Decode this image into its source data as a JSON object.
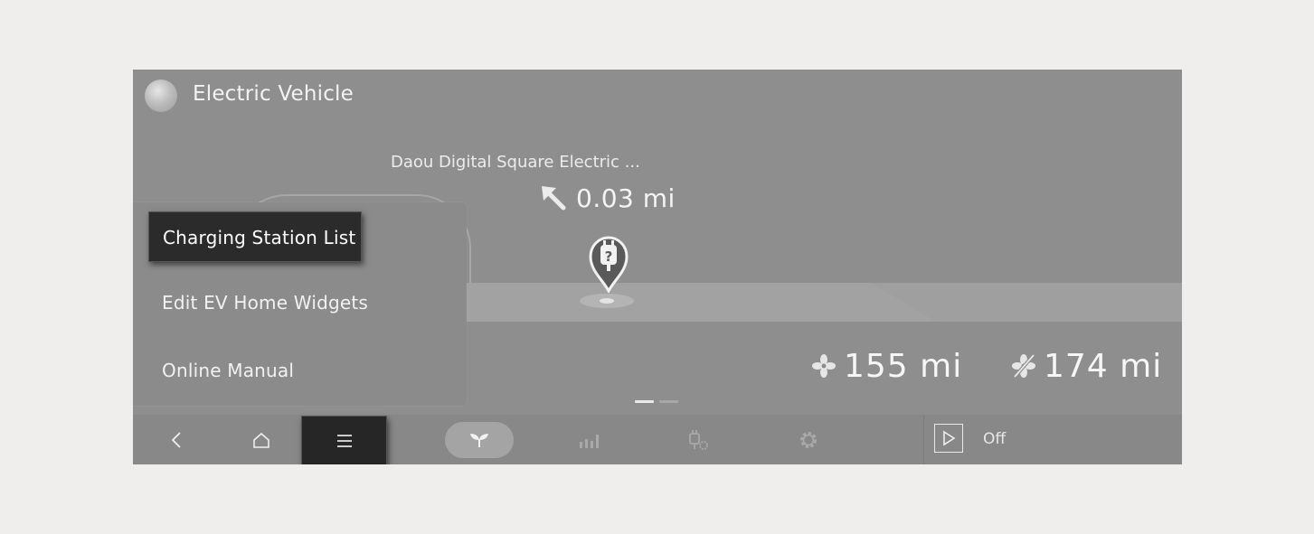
{
  "header": {
    "title": "Electric Vehicle",
    "icon": "app-globe-icon"
  },
  "navigation": {
    "station_name": "Daou Digital Square Electric ...",
    "distance": "0.03 mi",
    "direction_icon": "arrow-up-left-icon",
    "pin_icon": "charging-station-pin-icon"
  },
  "range": [
    {
      "icon": "fan-on-icon",
      "value": "155 mi"
    },
    {
      "icon": "fan-off-icon",
      "value": "174 mi"
    }
  ],
  "page_indicator": {
    "count": 2,
    "active": 0
  },
  "menu": {
    "items": [
      {
        "label": "Charging Station List",
        "selected": true
      },
      {
        "label": "Edit EV Home Widgets",
        "selected": false
      },
      {
        "label": "Online Manual",
        "selected": false
      }
    ]
  },
  "bottom_nav": {
    "buttons": [
      "back-icon",
      "home-icon",
      "menu-icon",
      "eco-leaf-icon",
      "stats-icon",
      "charging-settings-icon",
      "gear-icon",
      "play-icon"
    ],
    "status_label": "Off"
  },
  "colors": {
    "screen_bg": "#8d8e8d",
    "selected_bg": "#2b2b2b",
    "text": "#f1f1f1"
  }
}
